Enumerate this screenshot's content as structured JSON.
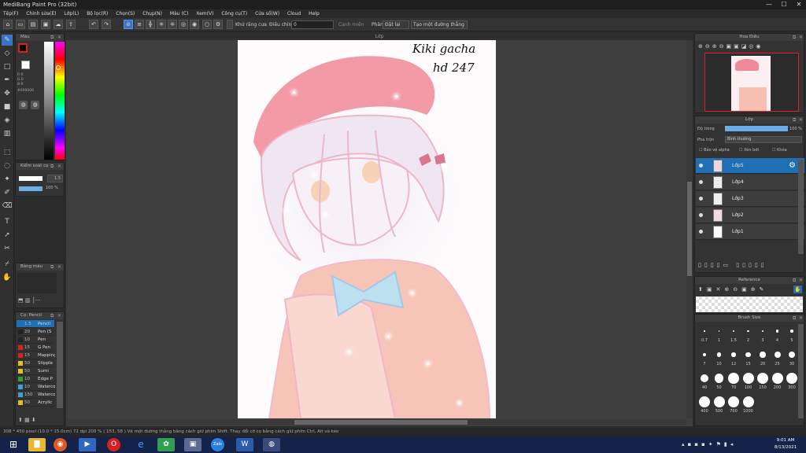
{
  "window": {
    "title": "MediBang Paint Pro (32bit)",
    "min": "—",
    "max": "☐",
    "close": "✕"
  },
  "menu": [
    "Tệp(F)",
    "Chỉnh sửa(E)",
    "Lớp(L)",
    "Bộ lọc(R)",
    "Chọn(S)",
    "Chụp(N)",
    "Màu (C)",
    "Xem(V)",
    "Công cụ(T)",
    "Cửa sổ(W)",
    "Cloud",
    "Help"
  ],
  "toolbar": {
    "antialias_label": "Khử răng cưa",
    "stabilizer_label": "Điều chỉnh",
    "stabilizer_value": "0",
    "canh_mien": "Cạnh miền",
    "phan_label": "Phân",
    "reset_label": "Đặt lại",
    "straight_line_label": "Tạo một đường thẳng"
  },
  "color_panel": {
    "title": "Màu",
    "r": "R 0",
    "g": "G 0",
    "b": "B 0",
    "hex": "#000000"
  },
  "brush_control": {
    "title": "Kiểm soát cọ",
    "size": "1.5",
    "opacity": "100 %"
  },
  "palette": {
    "title": "Bảng màu"
  },
  "brush_list": {
    "title": "Cọ: Pencil",
    "items": [
      {
        "size": "1.5",
        "name": "Pencil",
        "color": "#1f6fb5"
      },
      {
        "size": "20",
        "name": "Pen (S",
        "color": "#222222"
      },
      {
        "size": "10",
        "name": "Pen",
        "color": "#222222"
      },
      {
        "size": "15",
        "name": "G Pen",
        "color": "#d82020"
      },
      {
        "size": "15",
        "name": "Mapping",
        "color": "#d82020"
      },
      {
        "size": "50",
        "name": "Stipple",
        "color": "#e0c020"
      },
      {
        "size": "50",
        "name": "Sumi",
        "color": "#e0c020"
      },
      {
        "size": "10",
        "name": "Edge P",
        "color": "#30a030"
      },
      {
        "size": "10",
        "name": "Watercolor",
        "color": "#3aa0d8"
      },
      {
        "size": "150",
        "name": "Watercolor",
        "color": "#3aa0d8"
      },
      {
        "size": "50",
        "name": "Acrylic",
        "color": "#e0c020"
      }
    ]
  },
  "canvas_tab": "Lớp",
  "navigator": {
    "title": "Hoa Điều"
  },
  "layer_panel": {
    "title": "Lớp",
    "opacity_label": "Độ trong",
    "opacity_value": "100 %",
    "blend_label": "Pha trộn",
    "blend_value": "Bình thường",
    "protect_alpha": "Bảo vệ alpha",
    "clipping": "Xén bớt",
    "lock": "Khóa",
    "layers": [
      "Lớp5",
      "Lớp4",
      "Lớp3",
      "Lớp2",
      "Lớp1"
    ]
  },
  "reference": {
    "title": "Reference"
  },
  "brush_size": {
    "title": "Brush Size",
    "sizes": [
      "0.7",
      "1",
      "1.5",
      "2",
      "3",
      "4",
      "5",
      "7",
      "10",
      "12",
      "15",
      "20",
      "25",
      "30",
      "40",
      "50",
      "70",
      "100",
      "150",
      "200",
      "300",
      "400",
      "500",
      "700",
      "1000"
    ]
  },
  "artwork": {
    "text1": "Kiki gacha",
    "text2": "hd 247"
  },
  "status": "308 * 450 pixel  (10.0 * 15.0cm)  72 dpi  200 %  ( 153, 58 )  Vẽ một đường thẳng bằng cách giữ phím Shift. Thay đổi cỡ cọ bằng cách giữ phím Ctrl, Alt và kéo",
  "clock": {
    "time": "9:01 AM",
    "date": "8/13/2021"
  },
  "colors": {
    "accent": "#1f6fb5",
    "taskbar": "#15234a"
  }
}
